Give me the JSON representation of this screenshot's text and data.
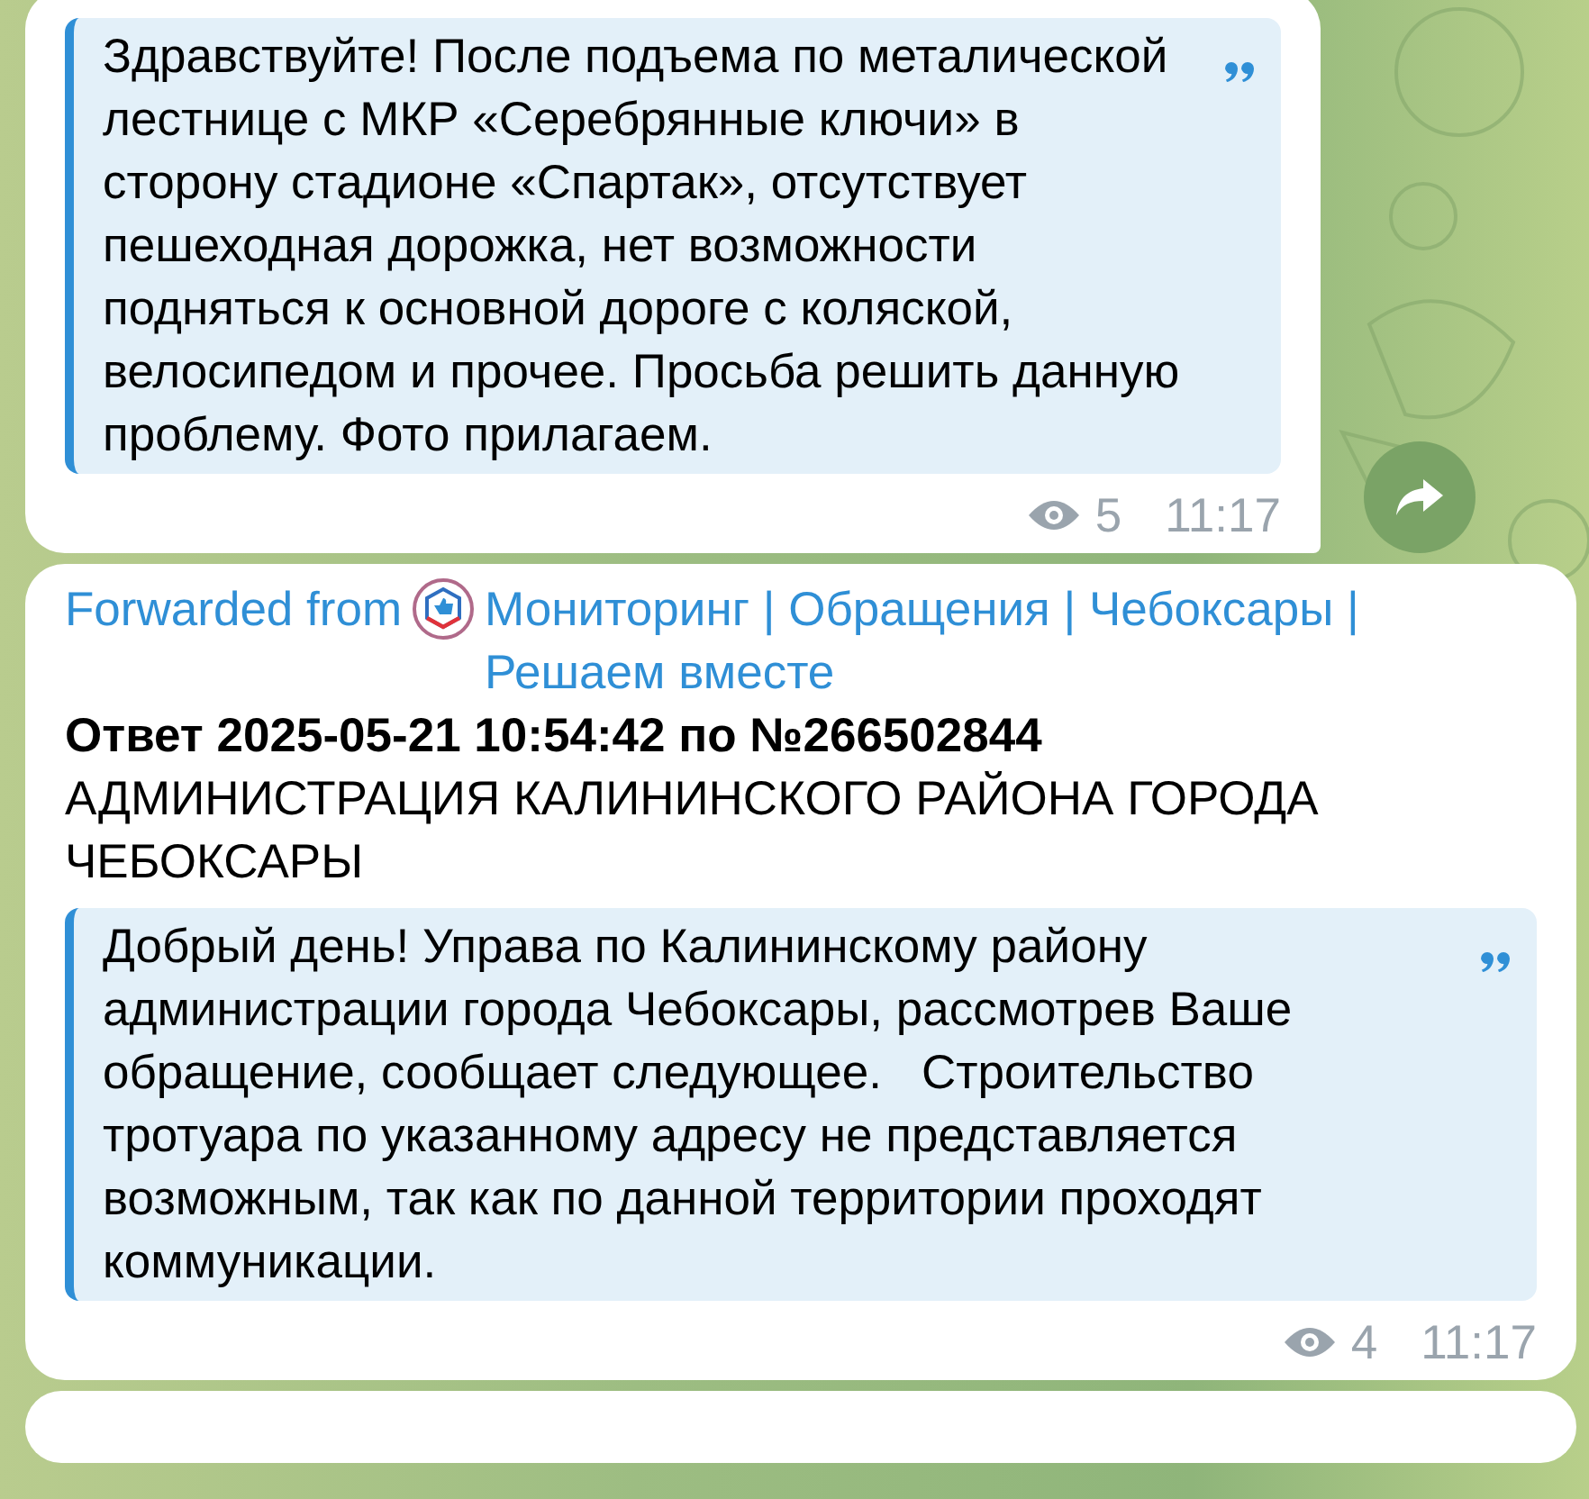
{
  "messages": [
    {
      "quote": "Здравствуйте! После подъема по металической лестнице с МКР «Серебрянные ключи» в сторону стадионе «Спартак», отсутствует пешеходная дорожка, нет возможности подняться к основной дороге с коляской, велосипедом и прочее. Просьба решить данную проблему. Фото прилагаем.",
      "views": "5",
      "time": "11:17",
      "share_button": true
    },
    {
      "forwarded_label": "Forwarded from",
      "channel": "Мониторинг | Обращения | Чебоксары | Решаем вместе",
      "title": "Ответ 2025-05-21 10:54:42 по №266502844",
      "body": "АДМИНИСТРАЦИЯ КАЛИНИНСКОГО РАЙОНА ГОРОДА ЧЕБОКСАРЫ",
      "quote": "Добрый день! Управа по Калининскому району администрации города Чебоксары, рассмотрев Ваше обращение, сообщает следующее.   Строительство тротуара по указанному адресу не представляется возможным, так как по данной территории проходят коммуникации.",
      "views": "4",
      "time": "11:17",
      "share_button": false
    }
  ]
}
